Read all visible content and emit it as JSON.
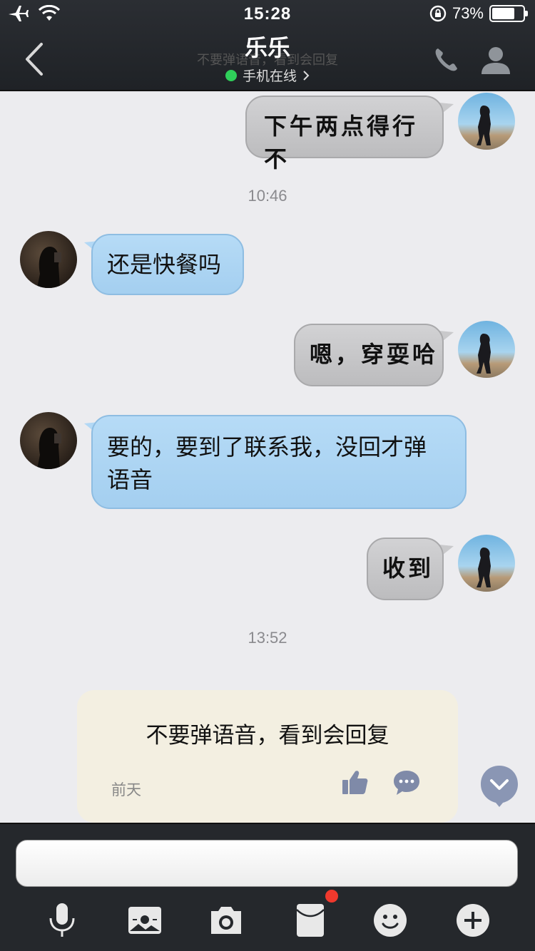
{
  "status_bar": {
    "time": "15:28",
    "battery_percent": "73%",
    "battery_level": 0.73
  },
  "header": {
    "title": "乐乐",
    "ghost_text": "不要弹语音，看到会回复",
    "online_status": "手机在线",
    "online_color": "#2fcf5a"
  },
  "messages": [
    {
      "side": "out",
      "text": "下午两点得行不"
    },
    {
      "type": "timestamp",
      "text": "10:46"
    },
    {
      "side": "in",
      "text": "还是快餐吗"
    },
    {
      "side": "out",
      "text": "嗯，穿耍哈"
    },
    {
      "side": "in",
      "text": "要的，要到了联系我，没回才弹语音",
      "line1": "要的，要到了联系我，没回才弹",
      "line2": "语音"
    },
    {
      "side": "out",
      "text": "收到"
    },
    {
      "type": "timestamp",
      "text": "13:52"
    }
  ],
  "pinned_note": {
    "text": "不要弹语音，看到会回复",
    "date": "前天"
  },
  "composer": {
    "value": "",
    "placeholder": ""
  },
  "toolbar": {
    "icons": [
      "microphone-icon",
      "picture-icon",
      "camera-icon",
      "red-packet-icon",
      "emoji-icon",
      "plus-icon"
    ],
    "badge_color": "#f0392d"
  }
}
